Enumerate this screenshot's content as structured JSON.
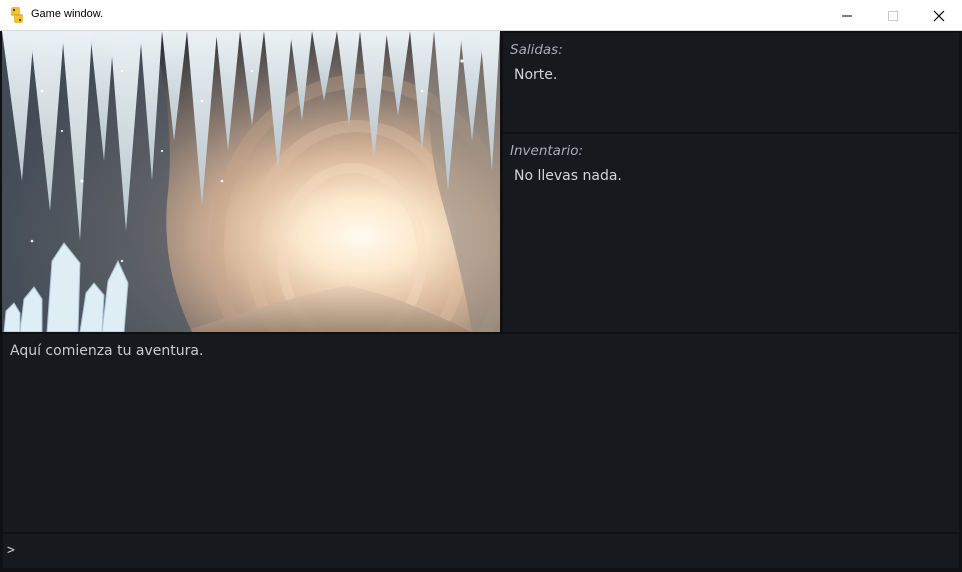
{
  "window": {
    "title": "Game window.",
    "icon": "python-icon",
    "controls": [
      "minimize-icon",
      "maximize-icon",
      "close-icon"
    ]
  },
  "scene": {
    "image": "crystal cave illustration",
    "colors": {
      "light": "#fff3dc",
      "crystal": "#e6eef2",
      "dark": "#2a3038"
    }
  },
  "exits": {
    "label": "Salidas:",
    "text": "Norte."
  },
  "inventory": {
    "label": "Inventario:",
    "text": "No llevas nada."
  },
  "narration": {
    "text": "Aquí comienza tu aventura."
  },
  "command": {
    "prompt": ">",
    "value": "",
    "placeholder": ""
  },
  "theme": {
    "panel_bg": "#16191d",
    "border": "#0e1014",
    "text": "#d2d5da",
    "label": "#a9adb4"
  }
}
